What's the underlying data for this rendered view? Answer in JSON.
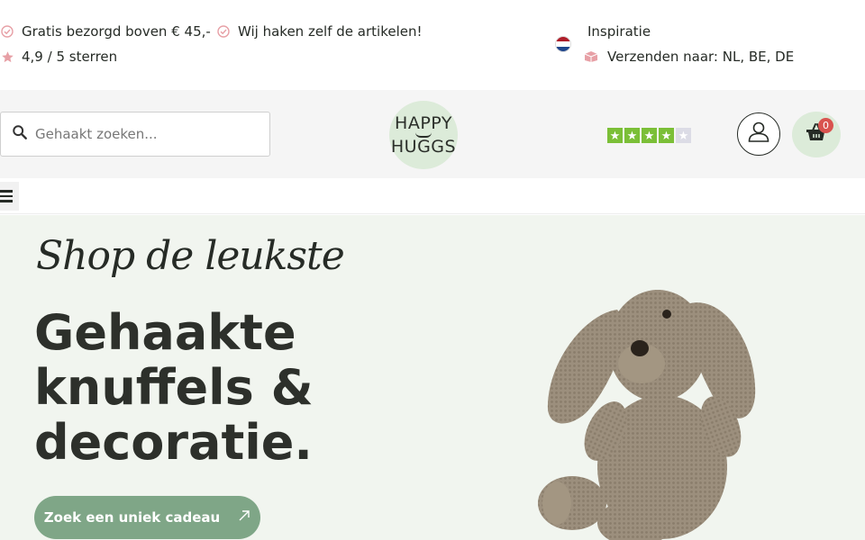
{
  "topbar": {
    "usp_free_shipping": "Gratis bezorgd boven € 45,-",
    "usp_handmade": "Wij haken zelf de artikelen!",
    "usp_rating": "4,9 / 5 sterren",
    "inspiration_link": "Inspiratie",
    "ship_to": "Verzenden naar: NL, BE, DE",
    "icons": [
      "check-circle-icon",
      "check-circle-icon",
      "star-icon",
      "netherlands-flag-icon",
      "box-icon"
    ],
    "colors": {
      "accent_pink": "#e7a0a6"
    }
  },
  "header": {
    "search_placeholder": "Gehaakt zoeken...",
    "logo_line1": "HAPPY",
    "logo_line2": "HUGGS",
    "trustpilot_stars": 4,
    "cart_count": "0",
    "colors": {
      "logo_bg": "#dcebd9",
      "trustpilot_green": "#7bbf37",
      "badge": "#d9534f"
    }
  },
  "nav": {
    "menu_icon": "hamburger-icon"
  },
  "hero": {
    "script_line": "Shop de leukste",
    "title": "Gehaakte knuffels & decoratie.",
    "cta_label": "Zoek een uniek cadeau",
    "cta_icon": "arrow-up-right-icon",
    "colors": {
      "bg": "#f1f5ef",
      "cta_bg": "#7fa687"
    }
  }
}
